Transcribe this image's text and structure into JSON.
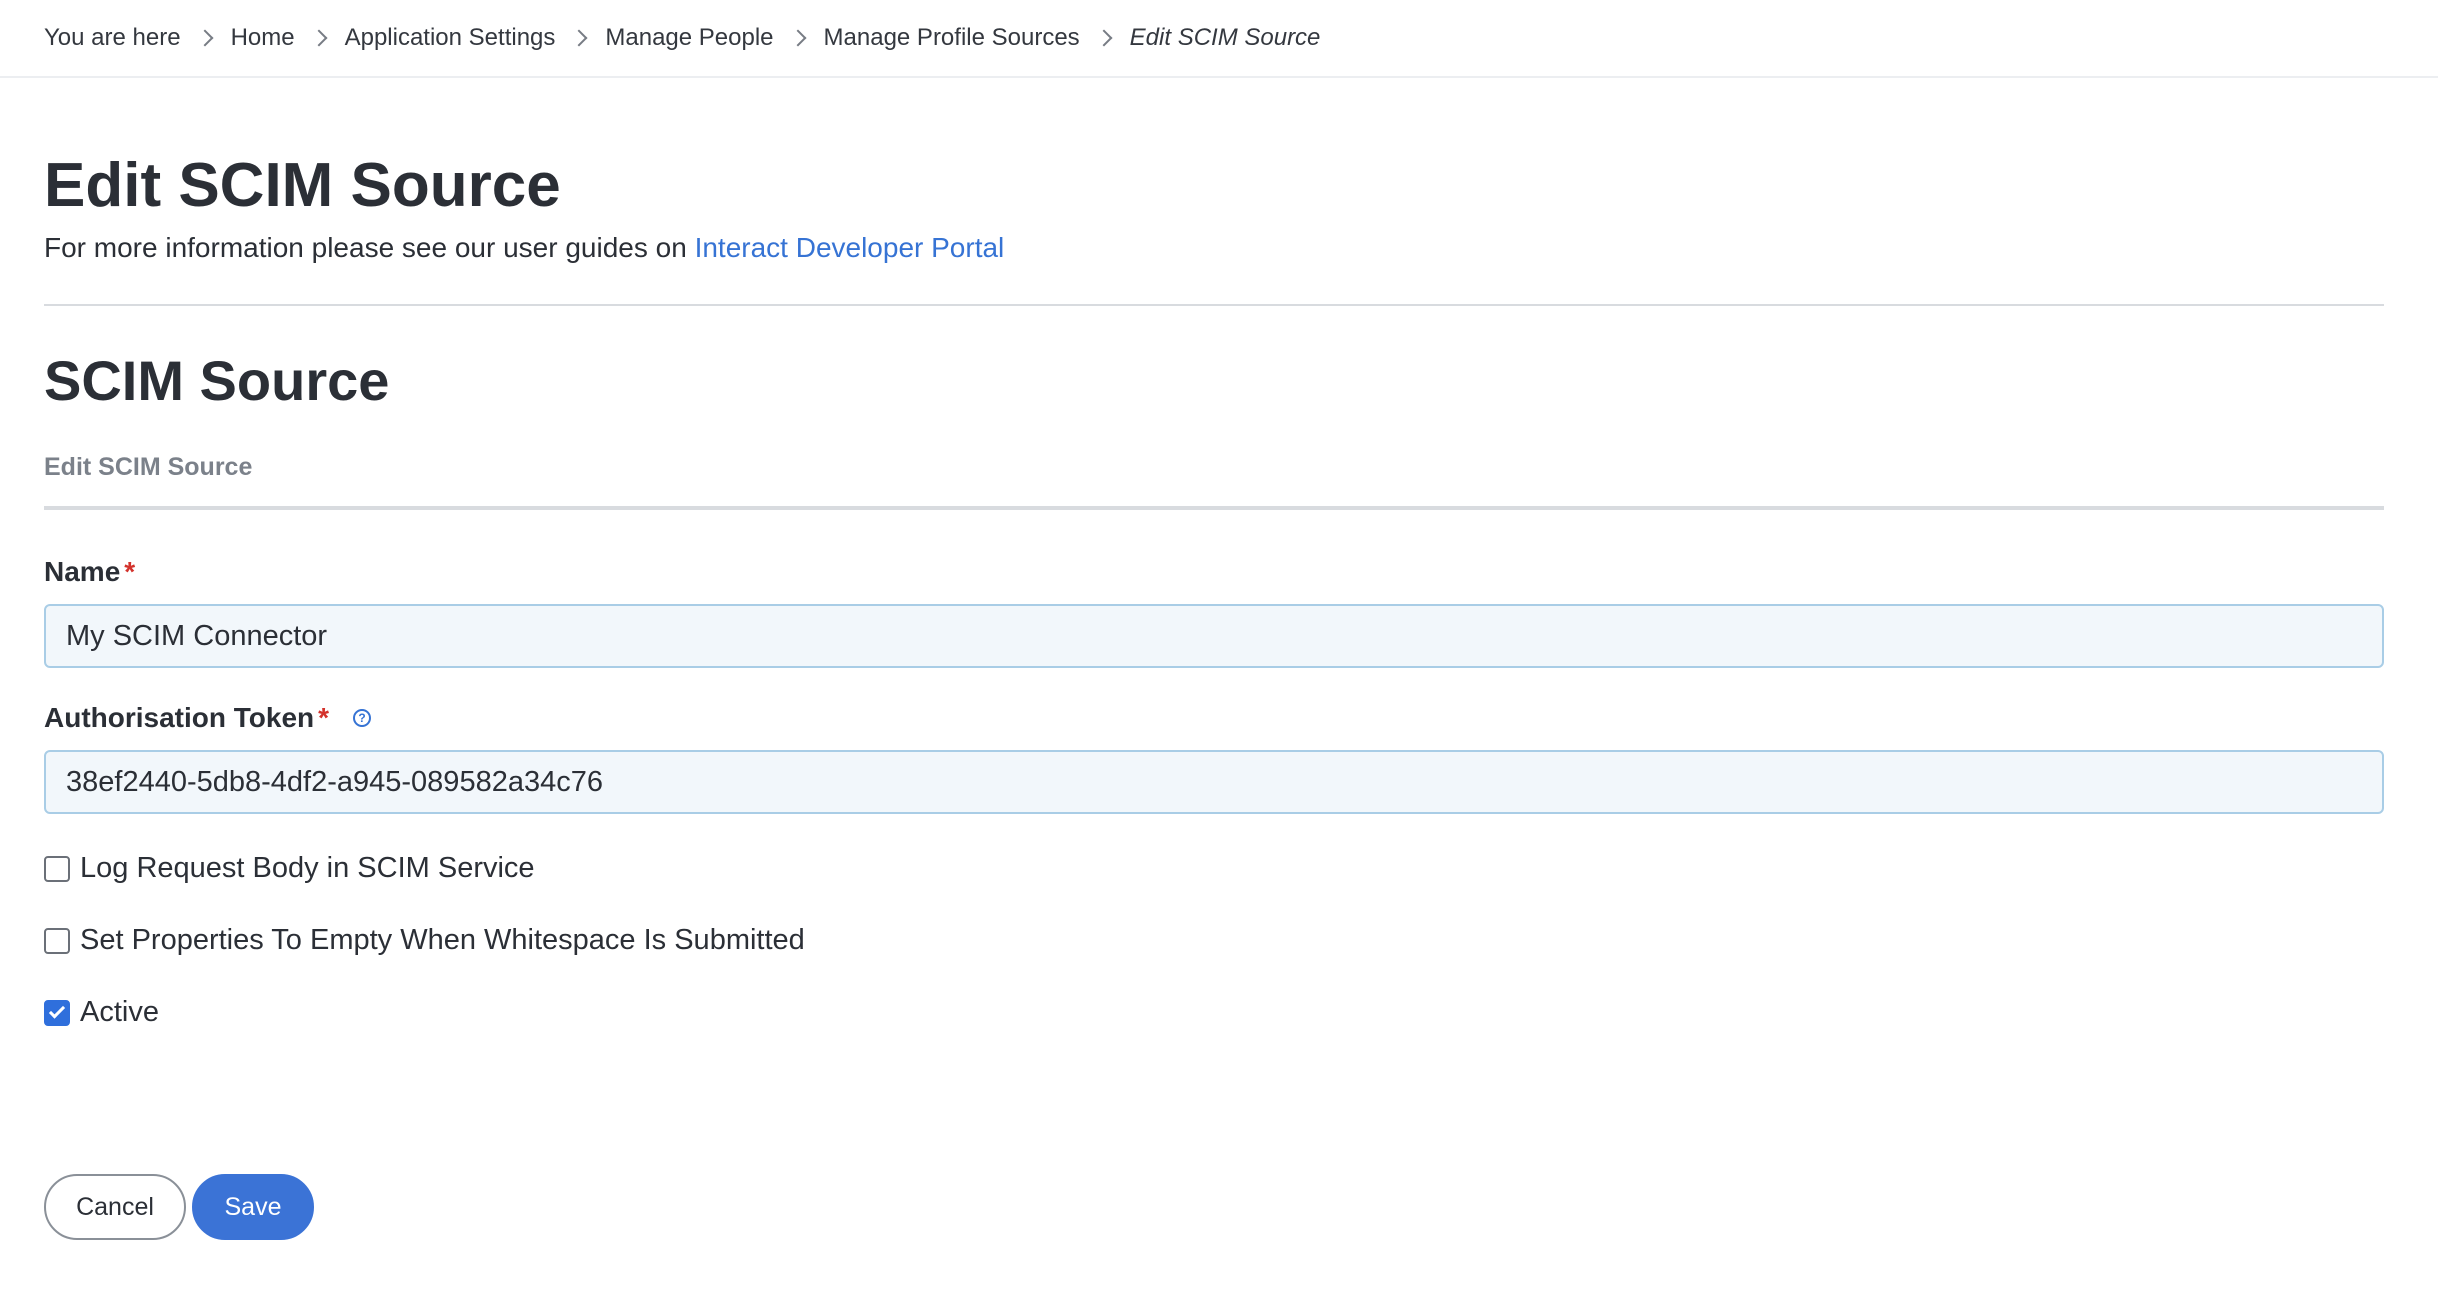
{
  "breadcrumb": {
    "prefix": "You are here",
    "items": [
      "Home",
      "Application Settings",
      "Manage People",
      "Manage Profile Sources"
    ],
    "current": "Edit SCIM Source"
  },
  "page": {
    "title": "Edit SCIM Source",
    "subtitle_text": "For more information please see our user guides on ",
    "subtitle_link": "Interact Developer Portal"
  },
  "section": {
    "title": "SCIM Source",
    "tab": "Edit SCIM Source"
  },
  "form": {
    "name": {
      "label": "Name",
      "required_mark": "*",
      "value": "My SCIM Connector"
    },
    "token": {
      "label": "Authorisation Token",
      "required_mark": "*",
      "help_icon": "question-circle-icon",
      "value": "38ef2440-5db8-4df2-a945-089582a34c76"
    },
    "checkboxes": [
      {
        "label": "Log Request Body in SCIM Service",
        "checked": false
      },
      {
        "label": "Set Properties To Empty When Whitespace Is Submitted",
        "checked": false
      },
      {
        "label": "Active",
        "checked": true
      }
    ]
  },
  "actions": {
    "cancel_label": "Cancel",
    "save_label": "Save"
  },
  "colors": {
    "link": "#3673d4",
    "primary": "#3b73d6",
    "required": "#d3322c"
  }
}
